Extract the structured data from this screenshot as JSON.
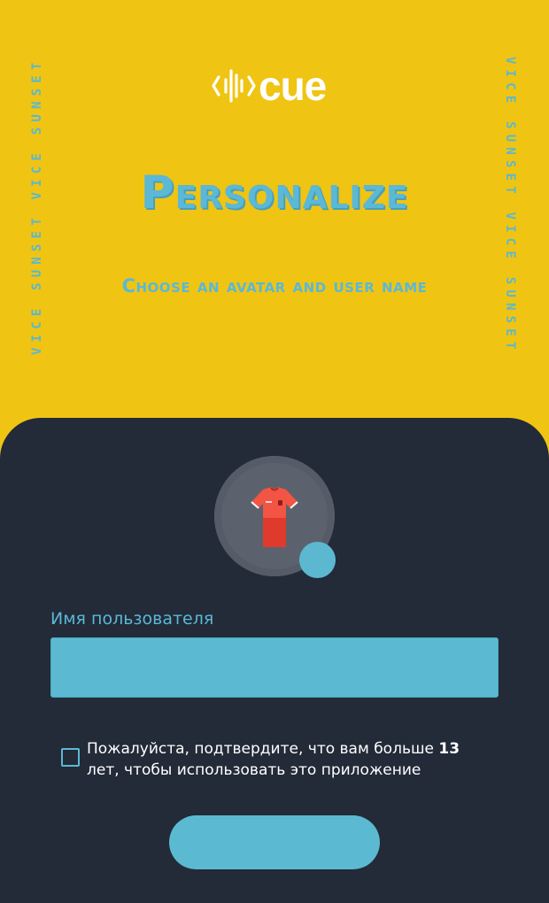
{
  "app": {
    "logo_text": "cue"
  },
  "side_text": {
    "left": "VICE SUNSET VICE SUNSET",
    "right": "VICE SUNSET VICE SUNSET"
  },
  "header": {
    "title": "Personalize",
    "subtitle": "Choose an avatar and user name"
  },
  "avatar": {
    "icon": "red-jersey-icon",
    "edit_icon": "edit-avatar-dot-icon"
  },
  "form": {
    "username_label": "Имя пользователя",
    "username_value": "",
    "username_placeholder": "",
    "consent_prefix": "Пожалуйста, подтвердите, что вам больше ",
    "consent_age": "13",
    "consent_suffix": " лет, чтобы использовать это приложение",
    "consent_checked": false,
    "submit_label": ""
  },
  "colors": {
    "background_yellow": "#f0c413",
    "panel_dark": "#232a38",
    "accent_blue": "#5bbad2",
    "jersey_red": "#f04a37"
  }
}
